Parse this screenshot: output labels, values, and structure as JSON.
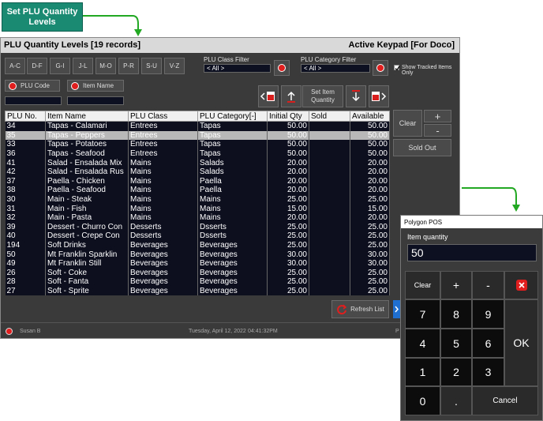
{
  "callout": {
    "label": "Set PLU Quantity Levels"
  },
  "window": {
    "title": "PLU Quantity Levels [19 records]",
    "keypad_status": "Active Keypad  [For Doco]"
  },
  "alpha_buttons": [
    "A-C",
    "D-F",
    "G-I",
    "J-L",
    "M-O",
    "P-R",
    "S-U",
    "V-Z"
  ],
  "filters": {
    "class_label": "PLU Class Filter",
    "class_value": "< All >",
    "category_label": "PLU Category Filter",
    "category_value": "< All >",
    "tracked_label": "Show Tracked Items Only"
  },
  "search": {
    "plu_code_label": "PLU Code",
    "item_name_label": "Item Name"
  },
  "set_qty_label": "Set Item Quantity",
  "side": {
    "clear": "Clear",
    "plus": "+",
    "minus": "-",
    "sold_out": "Sold Out"
  },
  "table": {
    "columns": [
      "PLU No.",
      "Item Name",
      "PLU Class",
      "PLU Category[-]",
      "Initial Qty",
      "Sold",
      "Available"
    ],
    "rows": [
      [
        "34",
        "Tapas - Calamari",
        "Entrees",
        "Tapas",
        "50.00",
        "",
        "50.00"
      ],
      [
        "35",
        "Tapas - Peppers",
        "Entrees",
        "Tapas",
        "50.00",
        "",
        "50.00"
      ],
      [
        "33",
        "Tapas - Potatoes",
        "Entrees",
        "Tapas",
        "50.00",
        "",
        "50.00"
      ],
      [
        "36",
        "Tapas - Seafood",
        "Entrees",
        "Tapas",
        "50.00",
        "",
        "50.00"
      ],
      [
        "41",
        "Salad - Ensalada Mix",
        "Mains",
        "Salads",
        "20.00",
        "",
        "20.00"
      ],
      [
        "42",
        "Salad - Ensalada Rus",
        "Mains",
        "Salads",
        "20.00",
        "",
        "20.00"
      ],
      [
        "37",
        "Paella - Chicken",
        "Mains",
        "Paella",
        "20.00",
        "",
        "20.00"
      ],
      [
        "38",
        "Paella - Seafood",
        "Mains",
        "Paella",
        "20.00",
        "",
        "20.00"
      ],
      [
        "30",
        "Main - Steak",
        "Mains",
        "Mains",
        "25.00",
        "",
        "25.00"
      ],
      [
        "31",
        "Main - Fish",
        "Mains",
        "Mains",
        "15.00",
        "",
        "15.00"
      ],
      [
        "32",
        "Main - Pasta",
        "Mains",
        "Mains",
        "20.00",
        "",
        "20.00"
      ],
      [
        "39",
        "Dessert - Churro Con",
        "Desserts",
        "Dsserts",
        "25.00",
        "",
        "25.00"
      ],
      [
        "40",
        "Dessert - Crepe Con",
        "Desserts",
        "Dsserts",
        "25.00",
        "",
        "25.00"
      ],
      [
        "194",
        "Soft Drinks",
        "Beverages",
        "Beverages",
        "25.00",
        "",
        "25.00"
      ],
      [
        "50",
        "Mt Franklin Sparklin",
        "Beverages",
        "Beverages",
        "30.00",
        "",
        "30.00"
      ],
      [
        "49",
        "Mt Franklin Still",
        "Beverages",
        "Beverages",
        "30.00",
        "",
        "30.00"
      ],
      [
        "26",
        "Soft - Coke",
        "Beverages",
        "Beverages",
        "25.00",
        "",
        "25.00"
      ],
      [
        "28",
        "Soft - Fanta",
        "Beverages",
        "Beverages",
        "25.00",
        "",
        "25.00"
      ],
      [
        "27",
        "Soft - Sprite",
        "Beverages",
        "Beverages",
        "25.00",
        "",
        "25.00"
      ]
    ]
  },
  "refresh_label": "Refresh List",
  "status_bar": {
    "user": "Susan B",
    "date": "Tuesday, April 12, 2022",
    "time": "04:41:32PM",
    "right": "P"
  },
  "popup": {
    "title": "Polygon POS",
    "field_label": "Item quantity",
    "field_value": "50",
    "keys": {
      "clear": "Clear",
      "plus": "+",
      "minus": "-",
      "k7": "7",
      "k8": "8",
      "k9": "9",
      "k4": "4",
      "k5": "5",
      "k6": "6",
      "ok": "OK",
      "k1": "1",
      "k2": "2",
      "k3": "3",
      "k0": "0",
      "dot": ".",
      "cancel": "Cancel"
    }
  },
  "colors": {
    "callout": "#1a8a73",
    "arrow": "#22a822",
    "danger": "#e01e1e"
  }
}
